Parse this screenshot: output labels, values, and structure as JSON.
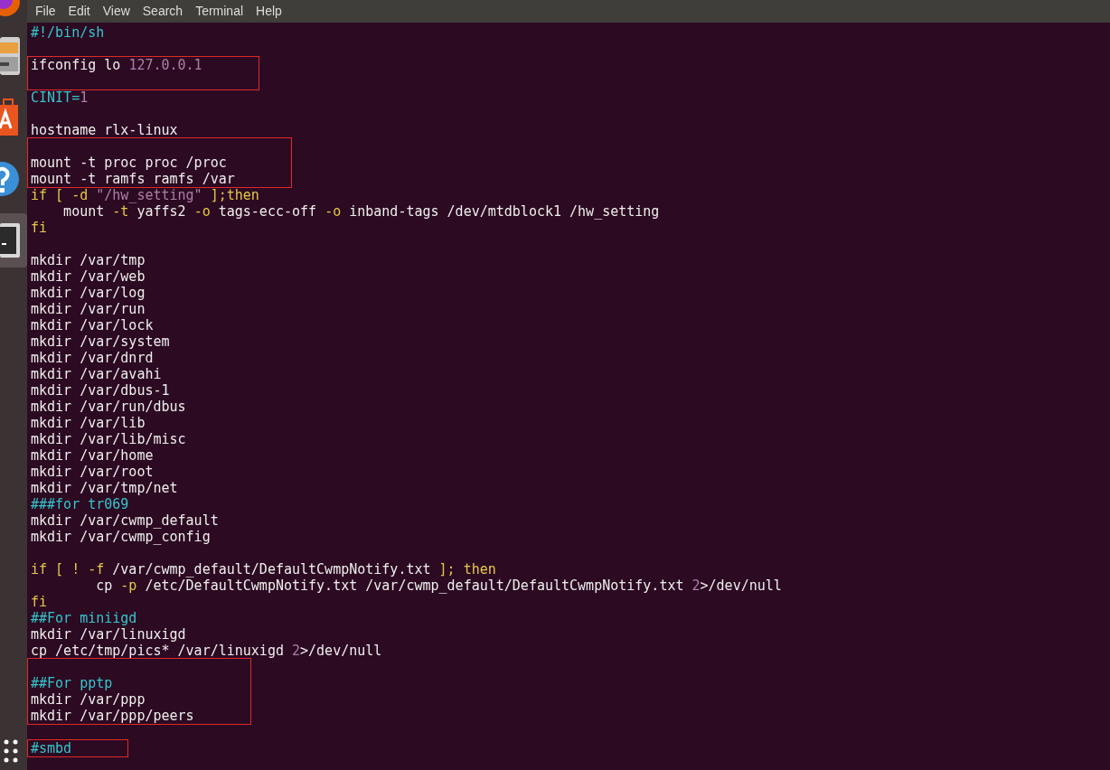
{
  "menu": [
    "File",
    "Edit",
    "View",
    "Search",
    "Terminal",
    "Help"
  ],
  "dock": [
    {
      "kind": "browser",
      "selected": false
    },
    {
      "kind": "files",
      "selected": false
    },
    {
      "kind": "store",
      "selected": false
    },
    {
      "kind": "help",
      "selected": false
    },
    {
      "kind": "terminal",
      "selected": true
    },
    {
      "kind": "apps",
      "selected": false
    }
  ],
  "blocks": [
    {
      "boxed": false,
      "lines": [
        {
          "kind": "code",
          "tokens": [
            {
              "kind": "comment",
              "text": "#!/bin/sh"
            }
          ]
        },
        {
          "kind": "blank"
        }
      ]
    },
    {
      "boxed": true,
      "lines": [
        {
          "kind": "code",
          "tokens": [
            {
              "kind": "plain",
              "text": "ifconfig lo "
            },
            {
              "kind": "number",
              "text": "127.0.0.1"
            }
          ]
        },
        {
          "kind": "blank"
        }
      ]
    },
    {
      "boxed": false,
      "lines": [
        {
          "kind": "code",
          "tokens": [
            {
              "kind": "comment",
              "text": "CINIT="
            },
            {
              "kind": "number",
              "text": "1"
            }
          ]
        },
        {
          "kind": "blank"
        },
        {
          "kind": "code",
          "tokens": [
            {
              "kind": "plain",
              "text": "hostname rlx-linux"
            }
          ]
        }
      ]
    },
    {
      "boxed": true,
      "lines": [
        {
          "kind": "blank"
        },
        {
          "kind": "code",
          "tokens": [
            {
              "kind": "plain",
              "text": "mount -t proc proc /proc"
            }
          ]
        },
        {
          "kind": "code",
          "tokens": [
            {
              "kind": "plain",
              "text": "mount -t ramfs ramfs /var"
            }
          ]
        }
      ]
    },
    {
      "boxed": false,
      "lines": [
        {
          "kind": "code",
          "tokens": [
            {
              "kind": "keyword",
              "text": "if [ -d "
            },
            {
              "kind": "string",
              "text": "\"/hw_setting\""
            },
            {
              "kind": "keyword",
              "text": " ];then"
            }
          ]
        },
        {
          "kind": "code",
          "tokens": [
            {
              "kind": "plain",
              "text": "    mount "
            },
            {
              "kind": "keyword",
              "text": "-t"
            },
            {
              "kind": "plain",
              "text": " yaffs2 "
            },
            {
              "kind": "keyword",
              "text": "-o"
            },
            {
              "kind": "plain",
              "text": " tags-ecc-off "
            },
            {
              "kind": "keyword",
              "text": "-o"
            },
            {
              "kind": "plain",
              "text": " inband-tags /dev/mtdblock1 /hw_setting"
            }
          ]
        },
        {
          "kind": "code",
          "tokens": [
            {
              "kind": "keyword",
              "text": "fi"
            }
          ]
        },
        {
          "kind": "blank"
        },
        {
          "kind": "code",
          "tokens": [
            {
              "kind": "plain",
              "text": "mkdir /var/tmp"
            }
          ]
        },
        {
          "kind": "code",
          "tokens": [
            {
              "kind": "plain",
              "text": "mkdir /var/web"
            }
          ]
        },
        {
          "kind": "code",
          "tokens": [
            {
              "kind": "plain",
              "text": "mkdir /var/log"
            }
          ]
        },
        {
          "kind": "code",
          "tokens": [
            {
              "kind": "plain",
              "text": "mkdir /var/run"
            }
          ]
        },
        {
          "kind": "code",
          "tokens": [
            {
              "kind": "plain",
              "text": "mkdir /var/lock"
            }
          ]
        },
        {
          "kind": "code",
          "tokens": [
            {
              "kind": "plain",
              "text": "mkdir /var/system"
            }
          ]
        },
        {
          "kind": "code",
          "tokens": [
            {
              "kind": "plain",
              "text": "mkdir /var/dnrd"
            }
          ]
        },
        {
          "kind": "code",
          "tokens": [
            {
              "kind": "plain",
              "text": "mkdir /var/avahi"
            }
          ]
        },
        {
          "kind": "code",
          "tokens": [
            {
              "kind": "plain",
              "text": "mkdir /var/dbus-1"
            }
          ]
        },
        {
          "kind": "code",
          "tokens": [
            {
              "kind": "plain",
              "text": "mkdir /var/run/dbus"
            }
          ]
        },
        {
          "kind": "code",
          "tokens": [
            {
              "kind": "plain",
              "text": "mkdir /var/lib"
            }
          ]
        },
        {
          "kind": "code",
          "tokens": [
            {
              "kind": "plain",
              "text": "mkdir /var/lib/misc"
            }
          ]
        },
        {
          "kind": "code",
          "tokens": [
            {
              "kind": "plain",
              "text": "mkdir /var/home"
            }
          ]
        },
        {
          "kind": "code",
          "tokens": [
            {
              "kind": "plain",
              "text": "mkdir /var/root"
            }
          ]
        },
        {
          "kind": "code",
          "tokens": [
            {
              "kind": "plain",
              "text": "mkdir /var/tmp/net"
            }
          ]
        },
        {
          "kind": "code",
          "tokens": [
            {
              "kind": "comment",
              "text": "###for tr069"
            }
          ]
        },
        {
          "kind": "code",
          "tokens": [
            {
              "kind": "plain",
              "text": "mkdir /var/cwmp_default"
            }
          ]
        },
        {
          "kind": "code",
          "tokens": [
            {
              "kind": "plain",
              "text": "mkdir /var/cwmp_config"
            }
          ]
        },
        {
          "kind": "blank"
        },
        {
          "kind": "code",
          "tokens": [
            {
              "kind": "keyword",
              "text": "if [ ! -f "
            },
            {
              "kind": "plain",
              "text": "/var/cwmp_default/DefaultCwmpNotify.txt"
            },
            {
              "kind": "keyword",
              "text": " ]; then"
            }
          ]
        },
        {
          "kind": "code",
          "tokens": [
            {
              "kind": "plain",
              "text": "        cp "
            },
            {
              "kind": "keyword",
              "text": "-p"
            },
            {
              "kind": "plain",
              "text": " /etc/DefaultCwmpNotify.txt /var/cwmp_default/DefaultCwmpNotify.txt "
            },
            {
              "kind": "number",
              "text": "2"
            },
            {
              "kind": "plain",
              "text": ">/dev/null"
            }
          ]
        },
        {
          "kind": "code",
          "tokens": [
            {
              "kind": "keyword",
              "text": "fi"
            }
          ]
        },
        {
          "kind": "code",
          "tokens": [
            {
              "kind": "comment",
              "text": "##For miniigd"
            }
          ]
        },
        {
          "kind": "code",
          "tokens": [
            {
              "kind": "plain",
              "text": "mkdir /var/linuxigd"
            }
          ]
        },
        {
          "kind": "code",
          "tokens": [
            {
              "kind": "plain",
              "text": "cp /etc/tmp/pics* /var/linuxigd "
            },
            {
              "kind": "number",
              "text": "2"
            },
            {
              "kind": "plain",
              "text": ">/dev/null"
            }
          ]
        }
      ]
    },
    {
      "boxed": true,
      "lines": [
        {
          "kind": "blank"
        },
        {
          "kind": "code",
          "tokens": [
            {
              "kind": "comment",
              "text": "##For pptp"
            }
          ]
        },
        {
          "kind": "code",
          "tokens": [
            {
              "kind": "plain",
              "text": "mkdir /var/ppp"
            }
          ]
        },
        {
          "kind": "code",
          "tokens": [
            {
              "kind": "plain",
              "text": "mkdir /var/ppp/peers"
            }
          ]
        }
      ]
    },
    {
      "boxed": false,
      "lines": [
        {
          "kind": "blank"
        }
      ]
    },
    {
      "boxed": true,
      "lines": [
        {
          "kind": "code",
          "tokens": [
            {
              "kind": "comment",
              "text": "#smbd"
            }
          ]
        }
      ]
    }
  ]
}
